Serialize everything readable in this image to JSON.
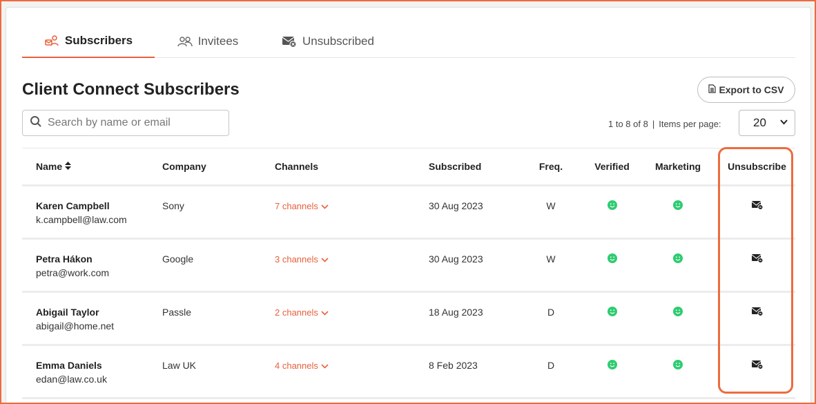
{
  "tabs": [
    {
      "label": "Subscribers",
      "icon": "subscribers-icon",
      "active": true
    },
    {
      "label": "Invitees",
      "icon": "users-icon",
      "active": false
    },
    {
      "label": "Unsubscribed",
      "icon": "mail-x-icon",
      "active": false
    }
  ],
  "page": {
    "title": "Client Connect Subscribers",
    "export_label": "Export to CSV"
  },
  "search": {
    "placeholder": "Search by name or email",
    "value": ""
  },
  "pagination": {
    "range": "1 to 8 of 8",
    "separator": "|",
    "items_label": "Items per page:",
    "per_page": "20"
  },
  "table": {
    "headers": {
      "name": "Name",
      "company": "Company",
      "channels": "Channels",
      "subscribed": "Subscribed",
      "freq": "Freq.",
      "verified": "Verified",
      "marketing": "Marketing",
      "unsubscribe": "Unsubscribe"
    },
    "rows": [
      {
        "name": "Karen Campbell",
        "email": "k.campbell@law.com",
        "company": "Sony",
        "channels": "7 channels",
        "subscribed": "30 Aug 2023",
        "freq": "W"
      },
      {
        "name": "Petra Hákon",
        "email": "petra@work.com",
        "company": "Google",
        "channels": "3 channels",
        "subscribed": "30 Aug 2023",
        "freq": "W"
      },
      {
        "name": "Abigail Taylor",
        "email": "abigail@home.net",
        "company": "Passle",
        "channels": "2 channels",
        "subscribed": "18 Aug 2023",
        "freq": "D"
      },
      {
        "name": "Emma Daniels",
        "email": "edan@law.co.uk",
        "company": "Law UK",
        "channels": "4 channels",
        "subscribed": "8 Feb 2023",
        "freq": "D"
      }
    ]
  },
  "colors": {
    "accent": "#e8603c",
    "success": "#2ecc71",
    "highlight": "#ec6b3e"
  }
}
